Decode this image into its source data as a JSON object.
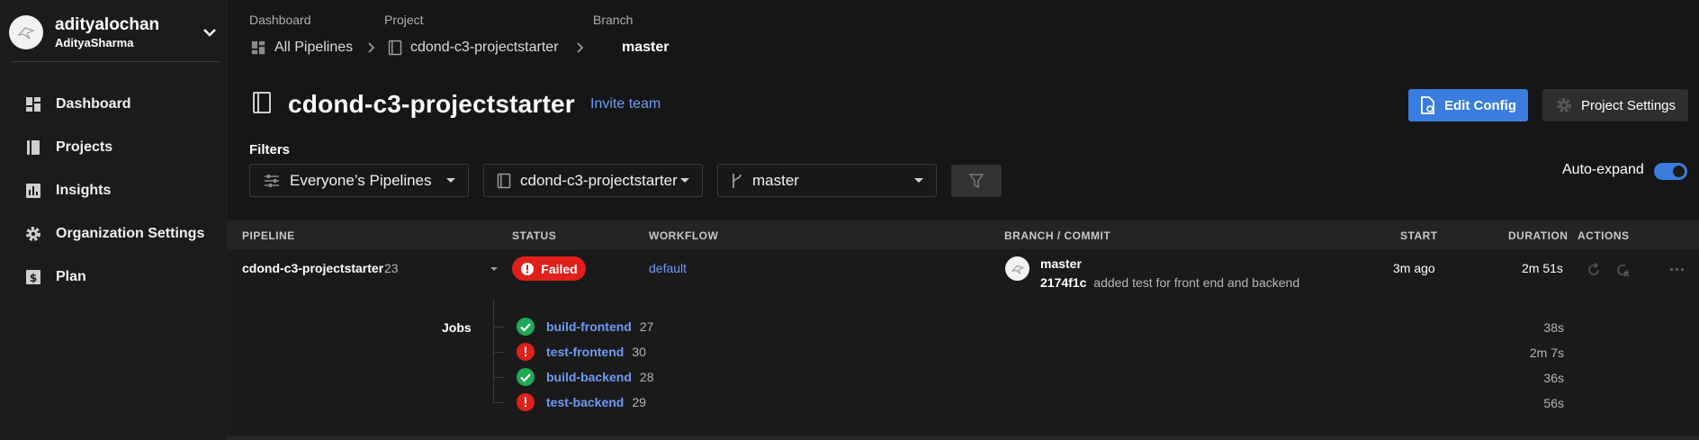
{
  "org": {
    "org_name": "adityalochan",
    "user_name": "AdityaSharma"
  },
  "sidebar": {
    "items": [
      {
        "label": "Dashboard",
        "icon": "dashboard-icon"
      },
      {
        "label": "Projects",
        "icon": "projects-icon"
      },
      {
        "label": "Insights",
        "icon": "insights-icon"
      },
      {
        "label": "Organization Settings",
        "icon": "gear-icon"
      },
      {
        "label": "Plan",
        "icon": "dollar-icon"
      }
    ]
  },
  "breadcrumb": {
    "dashboard_head": "Dashboard",
    "dashboard_link": "All Pipelines",
    "project_head": "Project",
    "project_link": "cdond-c3-projectstarter",
    "branch_head": "Branch",
    "branch_current": "master"
  },
  "header": {
    "project_title": "cdond-c3-projectstarter",
    "invite_label": "Invite team",
    "edit_config_label": "Edit Config",
    "project_settings_label": "Project Settings"
  },
  "filters": {
    "label": "Filters",
    "pipelines_value": "Everyone’s Pipelines",
    "project_value": "cdond-c3-projectstarter",
    "branch_value": "master",
    "auto_expand_label": "Auto-expand",
    "auto_expand_on": true
  },
  "table": {
    "headers": {
      "pipeline": "PIPELINE",
      "status": "STATUS",
      "workflow": "WORKFLOW",
      "branch_commit": "BRANCH / COMMIT",
      "start": "START",
      "duration": "DURATION",
      "actions": "ACTIONS"
    },
    "row": {
      "pipeline_name": "cdond-c3-projectstarter",
      "pipeline_number": "23",
      "status": "Failed",
      "workflow": "default",
      "branch": "master",
      "commit_hash": "2174f1c",
      "commit_message": "added test for front end and backend",
      "start": "3m ago",
      "duration": "2m 51s"
    },
    "jobs_label": "Jobs",
    "jobs": [
      {
        "name": "build-frontend",
        "number": "27",
        "status": "success",
        "duration": "38s"
      },
      {
        "name": "test-frontend",
        "number": "30",
        "status": "failed",
        "duration": "2m 7s"
      },
      {
        "name": "build-backend",
        "number": "28",
        "status": "success",
        "duration": "36s"
      },
      {
        "name": "test-backend",
        "number": "29",
        "status": "failed",
        "duration": "56s"
      }
    ]
  },
  "colors": {
    "accent": "#3a7dde",
    "link": "#6e9bf5",
    "failed": "#e0201a",
    "success": "#1fa855"
  }
}
